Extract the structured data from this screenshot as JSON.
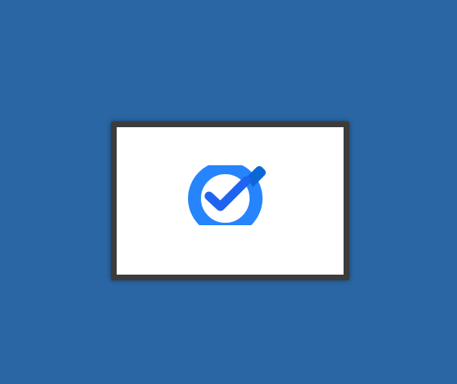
{
  "desktop": {
    "background_color": "#2a66a3"
  },
  "splash": {
    "background_color": "#ffffff",
    "border_color": "#3c3c3c",
    "icon": {
      "name": "google-tasks-check-icon",
      "ring_color": "#2684fc",
      "check_color": "#1e64f0",
      "check_tail_color": "#0c67d6"
    }
  }
}
